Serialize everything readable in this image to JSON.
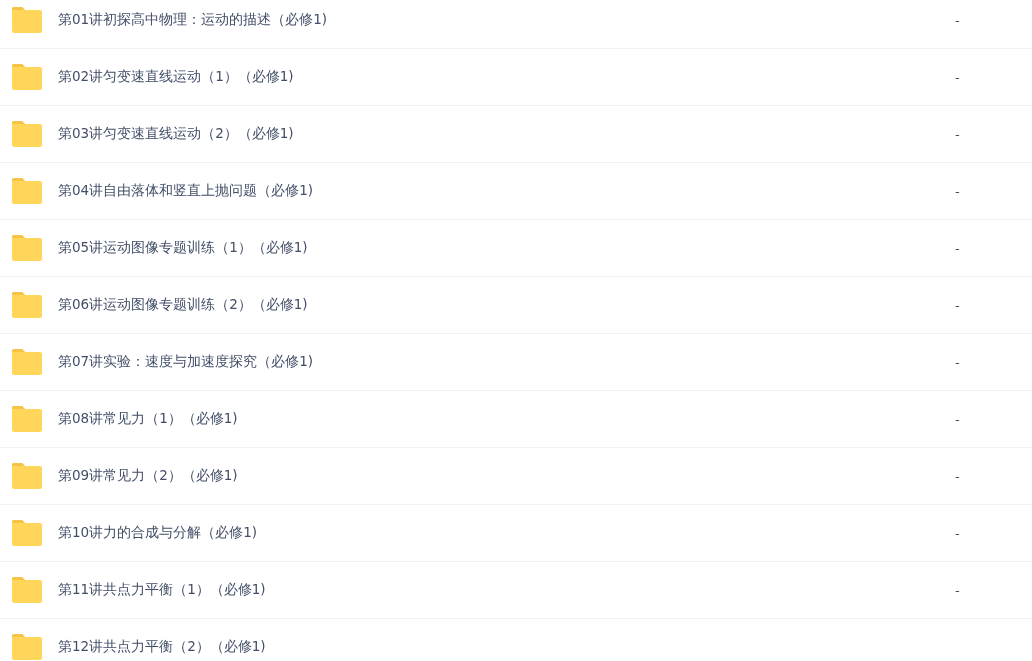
{
  "files": [
    {
      "name": "第01讲初探高中物理：运动的描述（必修1)",
      "size": "-"
    },
    {
      "name": "第02讲匀变速直线运动（1）（必修1)",
      "size": "-"
    },
    {
      "name": "第03讲匀变速直线运动（2）（必修1)",
      "size": "-"
    },
    {
      "name": "第04讲自由落体和竖直上抛问题（必修1)",
      "size": "-"
    },
    {
      "name": "第05讲运动图像专题训练（1）（必修1)",
      "size": "-"
    },
    {
      "name": "第06讲运动图像专题训练（2）（必修1)",
      "size": "-"
    },
    {
      "name": "第07讲实验：速度与加速度探究（必修1)",
      "size": "-"
    },
    {
      "name": "第08讲常见力（1）（必修1)",
      "size": "-"
    },
    {
      "name": "第09讲常见力（2）（必修1)",
      "size": "-"
    },
    {
      "name": "第10讲力的合成与分解（必修1)",
      "size": "-"
    },
    {
      "name": "第11讲共点力平衡（1）（必修1)",
      "size": "-"
    },
    {
      "name": "第12讲共点力平衡（2）（必修1)"
    }
  ]
}
